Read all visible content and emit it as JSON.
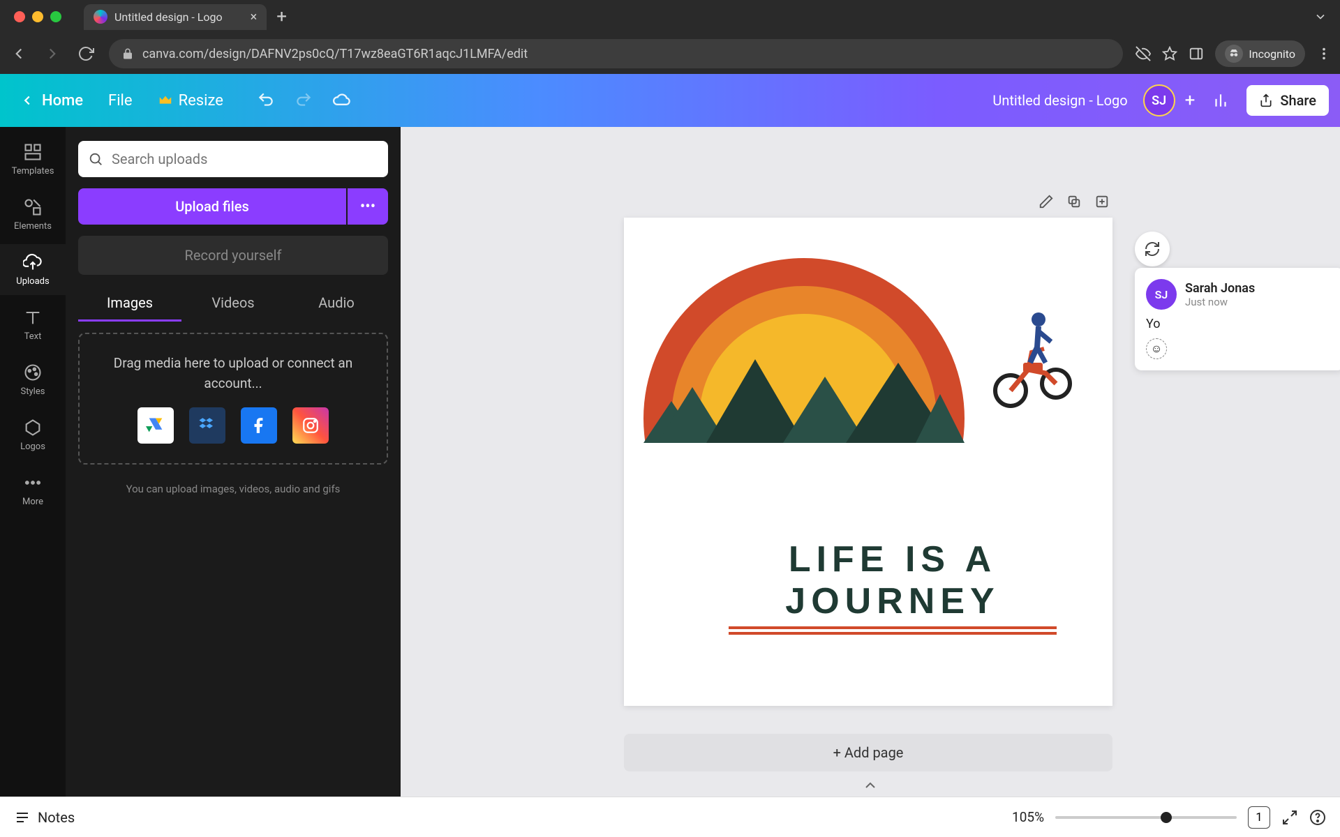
{
  "browser": {
    "tab_title": "Untitled design - Logo",
    "url": "canva.com/design/DAFNV2ps0cQ/T17wz8eaGT6R1aqcJ1LMFA/edit",
    "incognito_label": "Incognito"
  },
  "topbar": {
    "home": "Home",
    "file": "File",
    "resize": "Resize",
    "doc_title": "Untitled design - Logo",
    "avatar_initials": "SJ",
    "share": "Share"
  },
  "rail": {
    "templates": "Templates",
    "elements": "Elements",
    "uploads": "Uploads",
    "text": "Text",
    "styles": "Styles",
    "logos": "Logos",
    "more": "More"
  },
  "panel": {
    "search_placeholder": "Search uploads",
    "upload_btn": "Upload files",
    "record_btn": "Record yourself",
    "tabs": {
      "images": "Images",
      "videos": "Videos",
      "audio": "Audio"
    },
    "drop_text": "Drag media here to upload or connect an account...",
    "hint": "You can upload images, videos, audio and gifs"
  },
  "canvas": {
    "headline": "LIFE IS A JOURNEY",
    "add_page": "+ Add page"
  },
  "comment": {
    "initials": "SJ",
    "name": "Sarah Jonas",
    "time": "Just now",
    "body": "Yo"
  },
  "footer": {
    "notes": "Notes",
    "zoom": "105%",
    "page_count": "1"
  }
}
